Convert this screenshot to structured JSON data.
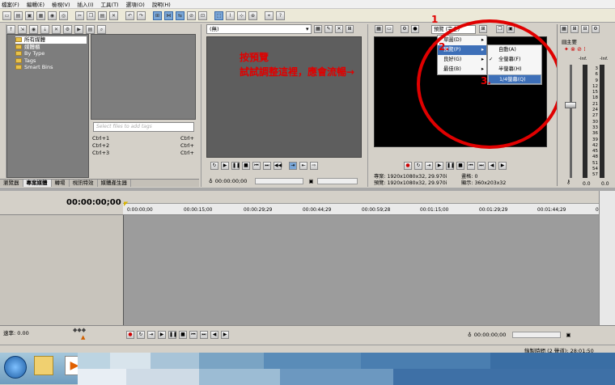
{
  "menubar": [
    "檔案(F)",
    "編輯(E)",
    "檢視(V)",
    "插入(I)",
    "工具(T)",
    "選項(O)",
    "說明(H)"
  ],
  "explorer": {
    "items": [
      "所有媒體",
      "媒體櫃",
      "By Type",
      "Tags",
      "Smart Bins"
    ],
    "search_placeholder": "Select files to add tags",
    "shortcuts": [
      {
        "key": "Ctrl+1",
        "val": "Ctrl+"
      },
      {
        "key": "Ctrl+2",
        "val": "Ctrl+"
      },
      {
        "key": "Ctrl+3",
        "val": "Ctrl+"
      }
    ]
  },
  "tabs": [
    "瀏覽器",
    "專案媒體",
    "轉場",
    "視訊特效",
    "媒體產生器"
  ],
  "trimmer": {
    "dropdown": "(無)",
    "timecode": "00:00:00;00"
  },
  "annotation": {
    "line1": "按預覽",
    "line2": "試試調整這裡，應會流暢→",
    "n1": "1",
    "n2": "2.",
    "n3": "3."
  },
  "preview": {
    "quality_dropdown": "預覽 (完全)",
    "project_label": "專案:",
    "project_val": "1920x1080x32, 29.970i",
    "preview_label": "預覽:",
    "preview_val": "1920x1080x32, 29.970i",
    "frame_label": "畫格:",
    "frame_val": "0",
    "display_label": "顯示:",
    "display_val": "360x203x32"
  },
  "quality_menu": [
    {
      "label": "草圖(D)",
      "arrow": "▸"
    },
    {
      "label": "預覽(P)",
      "arrow": "▸"
    },
    {
      "label": "良好(G)",
      "arrow": "▸"
    },
    {
      "label": "最佳(B)",
      "arrow": "▸"
    }
  ],
  "size_menu": [
    {
      "label": "自動(A)",
      "check": ""
    },
    {
      "label": "全螢幕(F)",
      "check": "✓"
    },
    {
      "label": "半螢幕(H)",
      "check": ""
    },
    {
      "label": "1/4螢幕(Q)",
      "check": ""
    }
  ],
  "mixer": {
    "title": "主要",
    "inf_left": "-Inf.",
    "inf_right": "-Inf.",
    "scale": [
      "3",
      "6",
      "9",
      "12",
      "15",
      "18",
      "21",
      "24",
      "27",
      "30",
      "33",
      "36",
      "39",
      "42",
      "45",
      "48",
      "51",
      "54",
      "57"
    ],
    "val_left": "0.0",
    "val_right": "0.0"
  },
  "timeline": {
    "timecode": "00:00:00;00",
    "ruler": [
      "0:00:00;00",
      "00:00:15;00",
      "00:00:29;29",
      "00:00:44;29",
      "00:00:59;28",
      "00:01:15;00",
      "00:01:29;29",
      "00:01:44;29",
      "00:0"
    ],
    "rate_label": "速率: 0.00",
    "bottom_timecode": "00:00:00;00",
    "record_time": "錄製時間 (2 聲道): 28:01:50"
  },
  "colors": {
    "accent_red": "#e00000",
    "menu_highlight": "#3d6fb8"
  }
}
